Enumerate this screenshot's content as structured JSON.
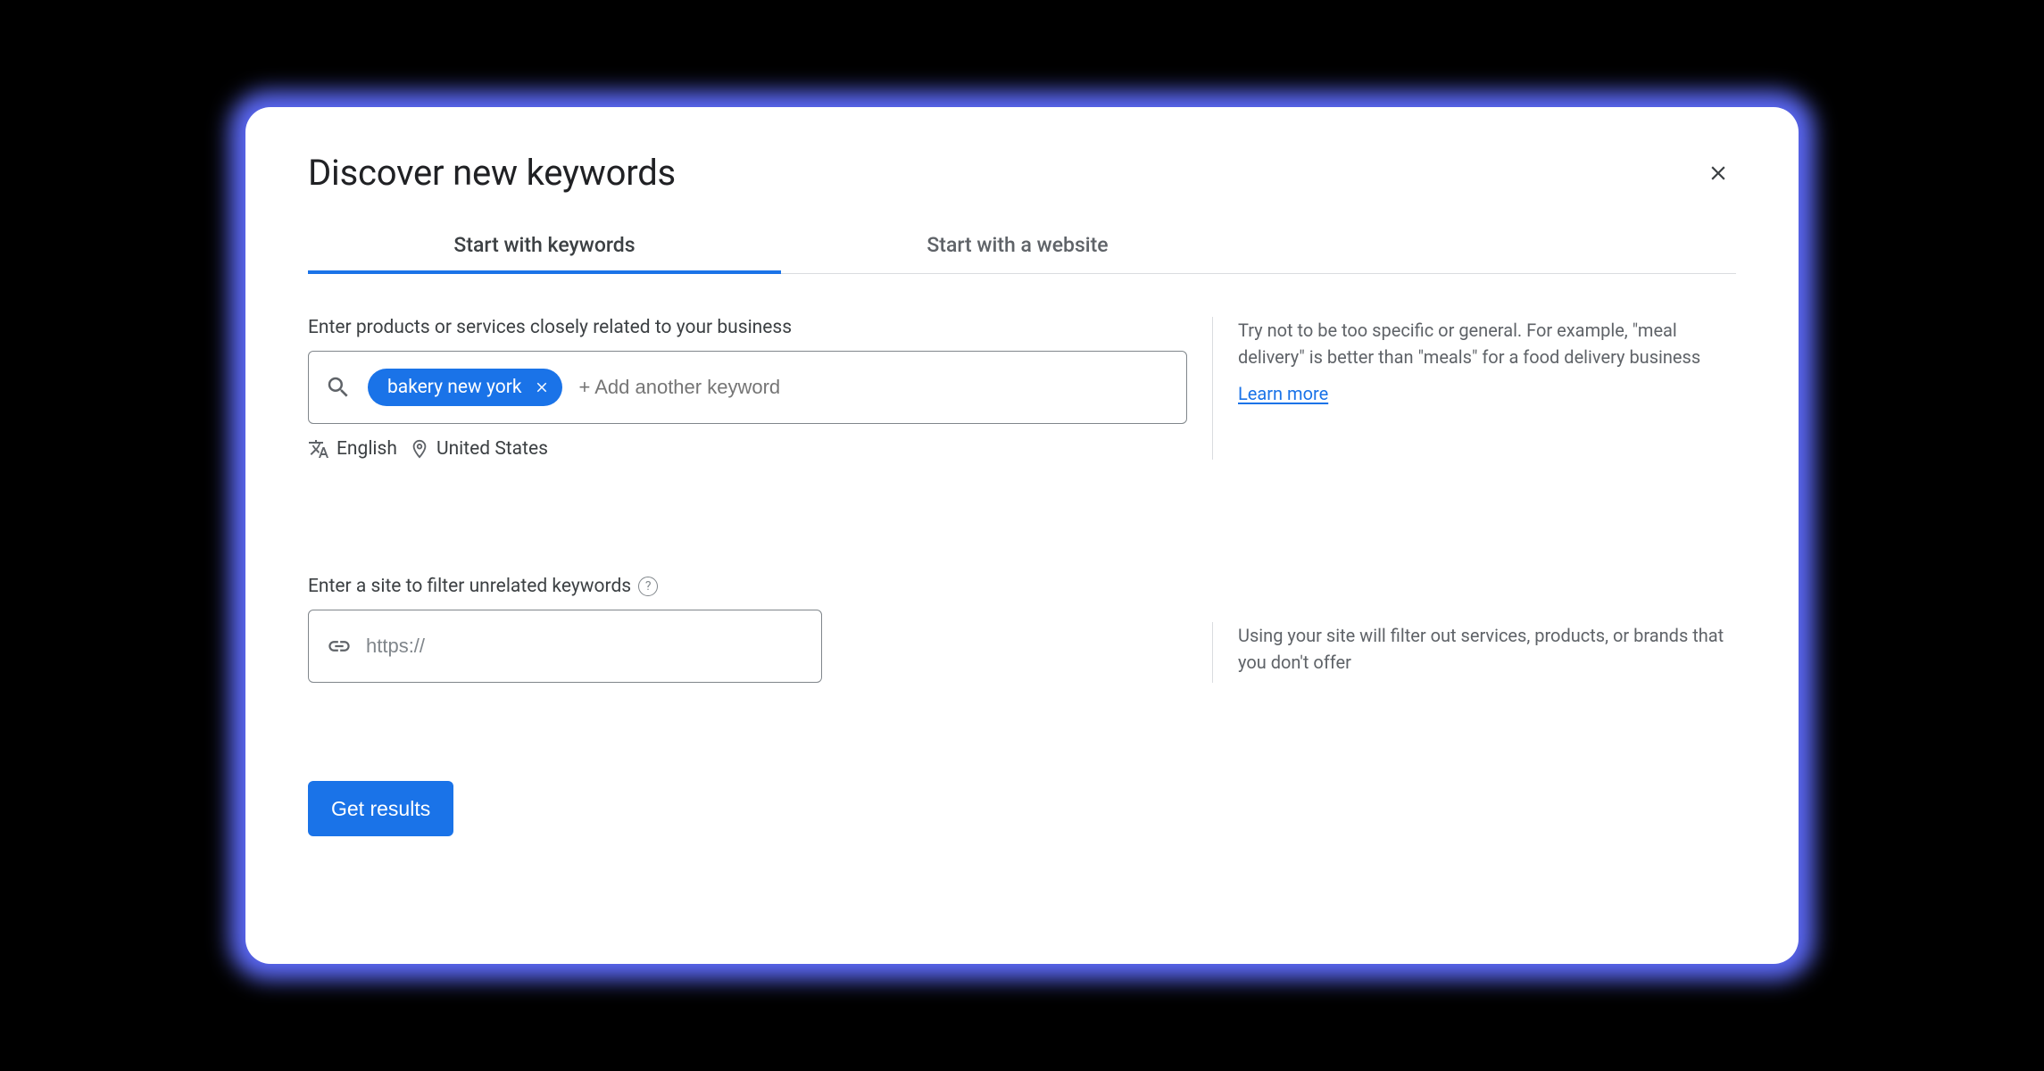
{
  "dialog": {
    "title": "Discover new keywords"
  },
  "tabs": [
    {
      "label": "Start with keywords",
      "active": true
    },
    {
      "label": "Start with a website",
      "active": false
    }
  ],
  "keywords_section": {
    "label": "Enter products or services closely related to your business",
    "chip": "bakery new york",
    "add_placeholder": "+ Add another keyword",
    "language": "English",
    "location": "United States",
    "help_text": "Try not to be too specific or general. For example, \"meal delivery\" is better than \"meals\" for a food delivery business",
    "learn_more": "Learn more"
  },
  "site_section": {
    "label": "Enter a site to filter unrelated keywords",
    "placeholder": "https://",
    "help_text": "Using your site will filter out services, products, or brands that you don't offer"
  },
  "actions": {
    "submit": "Get results"
  }
}
